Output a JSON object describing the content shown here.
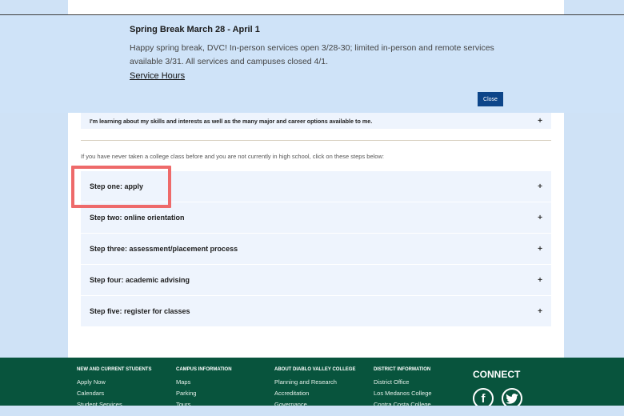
{
  "alert": {
    "title": "Spring Break March 28 - April 1",
    "body": "Happy spring break, DVC! In-person services open 3/28-30; limited in-person and remote services available 3/31. All services and campuses closed 4/1.",
    "link": "Service Hours",
    "close_label": "Close"
  },
  "top_item": {
    "label": "I'm learning about my skills and interests as well as the many major and career options available to me.",
    "toggle": "+"
  },
  "intro_text": "If you have never taken a college class before and you are not currently in high school, click on these steps below:",
  "steps": [
    {
      "label": "Step one: apply",
      "toggle": "+"
    },
    {
      "label": "Step two: online orientation",
      "toggle": "+"
    },
    {
      "label": "Step three: assessment/placement process",
      "toggle": "+"
    },
    {
      "label": "Step four: academic advising",
      "toggle": "+"
    },
    {
      "label": "Step five: register for classes",
      "toggle": "+"
    }
  ],
  "footer": {
    "columns": [
      {
        "heading": "NEW AND CURRENT STUDENTS",
        "links": [
          "Apply Now",
          "Calendars",
          "Student Services"
        ]
      },
      {
        "heading": "CAMPUS INFORMATION",
        "links": [
          "Maps",
          "Parking",
          "Tours"
        ]
      },
      {
        "heading": "ABOUT DIABLO VALLEY COLLEGE",
        "links": [
          "Planning and Research",
          "Accreditation",
          "Governance"
        ]
      },
      {
        "heading": "DISTRICT INFORMATION",
        "links": [
          "District Office",
          "Los Medanos College",
          "Contra Costa College"
        ]
      }
    ],
    "connect": "CONNECT",
    "social": [
      {
        "icon": "facebook-icon",
        "glyph": "f"
      },
      {
        "icon": "twitter-icon",
        "glyph": "t"
      }
    ]
  },
  "colors": {
    "banner": "#cfe3f8",
    "close_button": "#0d4589",
    "accordion": "#eef4fd",
    "footer": "#08543d",
    "highlight": "#ee6a6a"
  }
}
